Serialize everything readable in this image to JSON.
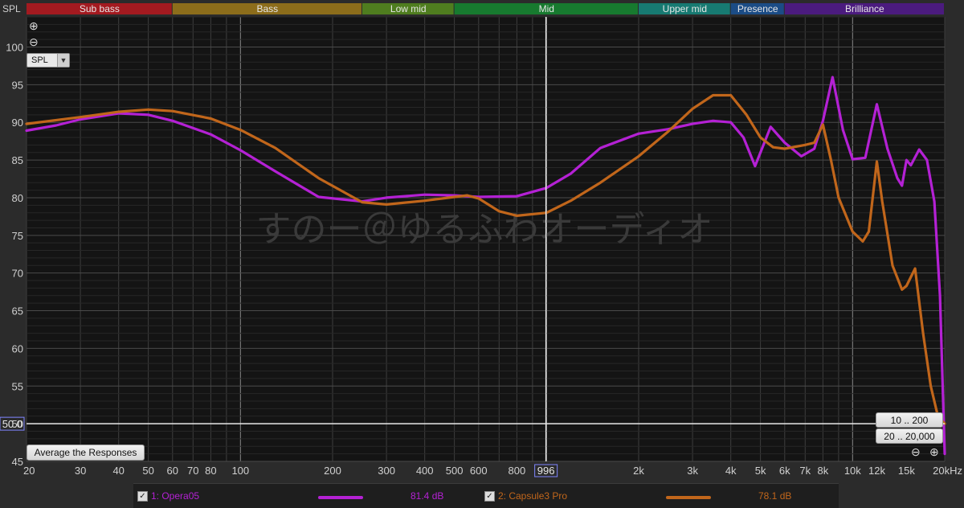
{
  "y_axis_label": "SPL",
  "spl_select": {
    "value": "SPL"
  },
  "bands": [
    {
      "label": "Sub bass",
      "from": 20,
      "to": 60,
      "color": "#a31a20"
    },
    {
      "label": "Bass",
      "from": 60,
      "to": 250,
      "color": "#8c6d1b"
    },
    {
      "label": "Low mid",
      "from": 250,
      "to": 500,
      "color": "#4f7d1f"
    },
    {
      "label": "Mid",
      "from": 500,
      "to": 2000,
      "color": "#177a2f"
    },
    {
      "label": "Upper mid",
      "from": 2000,
      "to": 4000,
      "color": "#177a72"
    },
    {
      "label": "Presence",
      "from": 4000,
      "to": 6000,
      "color": "#1b4c86"
    },
    {
      "label": "Brilliance",
      "from": 6000,
      "to": 20000,
      "color": "#4b1b7e"
    }
  ],
  "watermark": "すのー＠ゆるふわオーディオ",
  "cursor": {
    "freq_label": "996",
    "spl_label": "50.0"
  },
  "buttons": {
    "average": "Average the Responses",
    "range1": "10 .. 200",
    "range2": "20 .. 20,000"
  },
  "zoom": {
    "in": "⊕",
    "out": "⊖"
  },
  "legend": [
    {
      "label": "1: Opera05",
      "value": "81.4 dB",
      "color": "#b421d4"
    },
    {
      "label": "2: Capsule3 Pro",
      "value": "78.1 dB",
      "color": "#c1661b"
    }
  ],
  "chart_data": {
    "type": "line",
    "x_scale": "log",
    "xlim": [
      20,
      20000
    ],
    "ylim": [
      45,
      104
    ],
    "grid": true,
    "ylabel": "SPL",
    "xlabel": "",
    "y_ticks": [
      45,
      50,
      55,
      60,
      65,
      70,
      75,
      80,
      85,
      90,
      95,
      100
    ],
    "x_ticks": [
      {
        "v": 20,
        "t": "20"
      },
      {
        "v": 30,
        "t": "30"
      },
      {
        "v": 40,
        "t": "40"
      },
      {
        "v": 50,
        "t": "50"
      },
      {
        "v": 60,
        "t": "60"
      },
      {
        "v": 70,
        "t": "70"
      },
      {
        "v": 80,
        "t": "80"
      },
      {
        "v": 100,
        "t": "100"
      },
      {
        "v": 200,
        "t": "200"
      },
      {
        "v": 300,
        "t": "300"
      },
      {
        "v": 400,
        "t": "400"
      },
      {
        "v": 500,
        "t": "500"
      },
      {
        "v": 600,
        "t": "600"
      },
      {
        "v": 800,
        "t": "800"
      },
      {
        "v": 2000,
        "t": "2k"
      },
      {
        "v": 3000,
        "t": "3k"
      },
      {
        "v": 4000,
        "t": "4k"
      },
      {
        "v": 5000,
        "t": "5k"
      },
      {
        "v": 6000,
        "t": "6k"
      },
      {
        "v": 7000,
        "t": "7k"
      },
      {
        "v": 8000,
        "t": "8k"
      },
      {
        "v": 10000,
        "t": "10k"
      },
      {
        "v": 12000,
        "t": "12k"
      },
      {
        "v": 15000,
        "t": "15k"
      },
      {
        "v": 20000,
        "t": "20kHz"
      }
    ],
    "series": [
      {
        "name": "1: Opera05",
        "color": "#b421d4",
        "points": [
          [
            20,
            88.9
          ],
          [
            25,
            89.6
          ],
          [
            30,
            90.4
          ],
          [
            40,
            91.2
          ],
          [
            50,
            91.0
          ],
          [
            60,
            90.2
          ],
          [
            80,
            88.4
          ],
          [
            100,
            86.3
          ],
          [
            130,
            83.5
          ],
          [
            180,
            80.1
          ],
          [
            250,
            79.5
          ],
          [
            300,
            80.0
          ],
          [
            400,
            80.4
          ],
          [
            500,
            80.3
          ],
          [
            600,
            80.1
          ],
          [
            800,
            80.2
          ],
          [
            1000,
            81.3
          ],
          [
            1200,
            83.2
          ],
          [
            1500,
            86.6
          ],
          [
            2000,
            88.5
          ],
          [
            2500,
            89.1
          ],
          [
            3000,
            89.8
          ],
          [
            3500,
            90.2
          ],
          [
            4000,
            90.0
          ],
          [
            4400,
            88.0
          ],
          [
            4800,
            84.2
          ],
          [
            5400,
            89.4
          ],
          [
            6000,
            87.3
          ],
          [
            6800,
            85.5
          ],
          [
            7500,
            86.5
          ],
          [
            8000,
            90.2
          ],
          [
            8600,
            96.0
          ],
          [
            9300,
            89.0
          ],
          [
            10000,
            85.1
          ],
          [
            11000,
            85.3
          ],
          [
            12000,
            92.4
          ],
          [
            13000,
            86.5
          ],
          [
            14000,
            82.6
          ],
          [
            14500,
            81.6
          ],
          [
            15000,
            85.0
          ],
          [
            15500,
            84.3
          ],
          [
            16500,
            86.4
          ],
          [
            17500,
            85.0
          ],
          [
            18500,
            79.5
          ],
          [
            19300,
            67.0
          ],
          [
            19800,
            52.0
          ],
          [
            20000,
            46.0
          ]
        ]
      },
      {
        "name": "2: Capsule3 Pro",
        "color": "#c1661b",
        "points": [
          [
            20,
            89.8
          ],
          [
            30,
            90.7
          ],
          [
            40,
            91.4
          ],
          [
            50,
            91.7
          ],
          [
            60,
            91.5
          ],
          [
            80,
            90.5
          ],
          [
            100,
            89.0
          ],
          [
            130,
            86.6
          ],
          [
            180,
            82.6
          ],
          [
            250,
            79.4
          ],
          [
            300,
            79.1
          ],
          [
            400,
            79.6
          ],
          [
            500,
            80.1
          ],
          [
            550,
            80.3
          ],
          [
            600,
            79.9
          ],
          [
            700,
            78.2
          ],
          [
            800,
            77.6
          ],
          [
            1000,
            78.0
          ],
          [
            1200,
            79.6
          ],
          [
            1500,
            82.0
          ],
          [
            2000,
            85.5
          ],
          [
            2500,
            88.8
          ],
          [
            3000,
            91.8
          ],
          [
            3500,
            93.6
          ],
          [
            4000,
            93.6
          ],
          [
            4500,
            91.0
          ],
          [
            5000,
            88.0
          ],
          [
            5500,
            86.7
          ],
          [
            6000,
            86.5
          ],
          [
            7000,
            87.0
          ],
          [
            7500,
            87.3
          ],
          [
            8000,
            89.7
          ],
          [
            8500,
            85.0
          ],
          [
            9000,
            80.0
          ],
          [
            10000,
            75.5
          ],
          [
            10800,
            74.2
          ],
          [
            11300,
            75.5
          ],
          [
            12000,
            84.8
          ],
          [
            12500,
            79.5
          ],
          [
            13500,
            71.0
          ],
          [
            14500,
            67.8
          ],
          [
            15000,
            68.3
          ],
          [
            16000,
            70.6
          ],
          [
            17000,
            62.0
          ],
          [
            18000,
            55.0
          ],
          [
            19000,
            51.0
          ],
          [
            20000,
            50.0
          ]
        ]
      }
    ]
  }
}
